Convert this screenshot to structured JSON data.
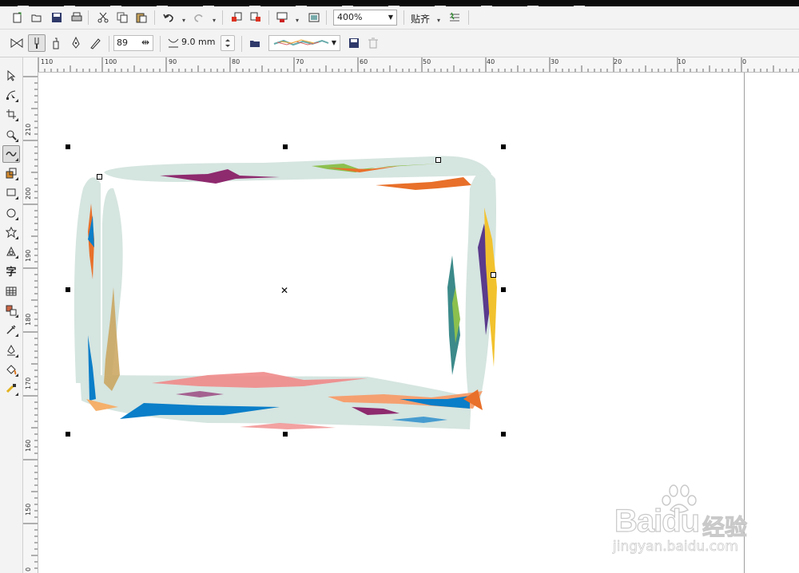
{
  "app": {
    "title": ""
  },
  "toolbar_standard": {
    "items": [
      "new-icon",
      "open-icon",
      "save-icon",
      "print-icon",
      "cut-icon",
      "copy-icon",
      "paste-icon",
      "undo-icon",
      "redo-icon",
      "import-icon",
      "export-icon",
      "publish-pdf-icon",
      "app-launcher-icon"
    ],
    "zoom": {
      "value": "400%"
    },
    "snap": {
      "label": "贴齐"
    }
  },
  "property_bar": {
    "smoothing_value": "89",
    "stroke_width": "9.0 mm"
  },
  "toolbox": {
    "tools": [
      "pick-tool-icon",
      "shape-tool-icon",
      "crop-tool-icon",
      "zoom-tool-icon",
      "artistic-media-tool-icon",
      "smart-fill-tool-icon",
      "rectangle-tool-icon",
      "ellipse-tool-icon",
      "star-tool-icon",
      "basic-shapes-icon",
      "text-tool-icon",
      "table-tool-icon",
      "blend-tool-icon",
      "eyedropper-tool-icon",
      "outline-pen-icon",
      "fill-tool-icon",
      "interactive-fill-icon"
    ],
    "active_tool": "artistic-media-tool-icon"
  },
  "ruler_h": {
    "labels": [
      "110",
      "100",
      "90",
      "80",
      "70",
      "60",
      "50",
      "40",
      "30",
      "20",
      "10",
      "0"
    ]
  },
  "ruler_v": {
    "labels": [
      "210",
      "200",
      "190",
      "180",
      "170",
      "160",
      "150",
      "0"
    ]
  },
  "canvas": {
    "frame_fill": "#d5e5e0",
    "accent_colors": [
      "#8e2a6e",
      "#e8702a",
      "#8cc04e",
      "#0a7ec8",
      "#f2c22e",
      "#f08a8a",
      "#3c8a8a",
      "#5a3a8c"
    ]
  },
  "watermark": {
    "brand": "Bai",
    "brand2": "du",
    "cn": "经验",
    "url": "jingyan.baidu.com"
  }
}
